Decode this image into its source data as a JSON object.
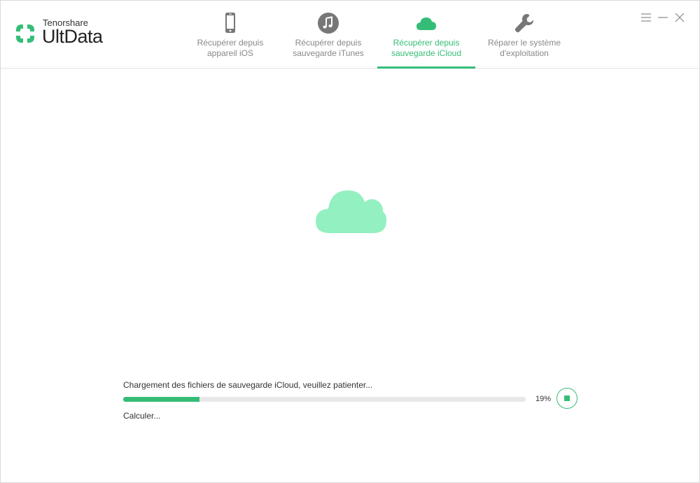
{
  "app": {
    "brand_small": "Tenorshare",
    "brand_large": "UltData",
    "accent_color": "#35bd77",
    "logo_icon": "ultdata-logo-icon"
  },
  "tabs": [
    {
      "label": "Récupérer depuis\nappareil iOS",
      "icon": "phone-icon",
      "active": false
    },
    {
      "label": "Récupérer depuis\nsauvegarde iTunes",
      "icon": "music-note-icon",
      "active": false
    },
    {
      "label": "Récupérer depuis\nsauvegarde iCloud",
      "icon": "cloud-icon",
      "active": true
    },
    {
      "label": "Réparer le système\nd'exploitation",
      "icon": "wrench-icon",
      "active": false
    }
  ],
  "window_controls": {
    "menu_icon": "menu-icon",
    "minimize_icon": "minimize-icon",
    "close_icon": "close-icon"
  },
  "main": {
    "cloud_icon": "cloud-icon",
    "cloud_color": "#93f0c0",
    "status_text": "Chargement des fichiers de sauvegarde iCloud, veuillez patienter...",
    "progress_percent": 19,
    "progress_label": "19%",
    "sub_status": "Calculer...",
    "stop_icon": "stop-icon"
  }
}
